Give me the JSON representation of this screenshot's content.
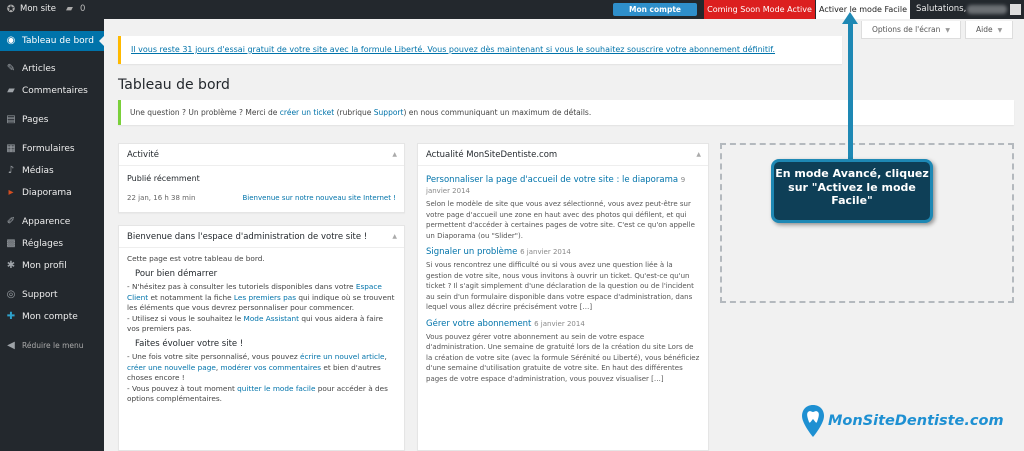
{
  "adminbar": {
    "site_name": "Mon site",
    "comments_count": "0",
    "mon_compte": "Mon compte",
    "coming_soon": "Coming Soon Mode Active",
    "activer_facile": "Activer le mode Facile",
    "salutations": "Salutations,"
  },
  "sidebar": {
    "items": [
      {
        "label": "Tableau de bord",
        "icon": "dashboard-icon"
      },
      {
        "label": "Articles",
        "icon": "pin-icon"
      },
      {
        "label": "Commentaires",
        "icon": "comment-icon"
      },
      {
        "label": "Pages",
        "icon": "page-icon"
      },
      {
        "label": "Formulaires",
        "icon": "forms-icon"
      },
      {
        "label": "Médias",
        "icon": "media-icon"
      },
      {
        "label": "Diaporama",
        "icon": "slideshow-icon"
      },
      {
        "label": "Apparence",
        "icon": "brush-icon"
      },
      {
        "label": "Réglages",
        "icon": "settings-icon"
      },
      {
        "label": "Mon profil",
        "icon": "gear-icon"
      },
      {
        "label": "Support",
        "icon": "lifebuoy-icon"
      },
      {
        "label": "Mon compte",
        "icon": "plus-icon"
      }
    ],
    "collapse": "Réduire le menu"
  },
  "screen_options": {
    "options": "Options de l'écran",
    "aide": "Aide"
  },
  "notice": {
    "trial": "Il vous reste 31 jours d'essai gratuit de votre site avec la formule Liberté. Vous pouvez dès maintenant si vous le souhaitez souscrire votre abonnement définitif."
  },
  "page_title": "Tableau de bord",
  "question": {
    "before": "Une question ? Un problème ? Merci de ",
    "link1": "créer un ticket",
    "middle": " (rubrique ",
    "link2": "Support",
    "after": ") en nous communiquant un maximum de détails."
  },
  "activite": {
    "title": "Activité",
    "subtitle": "Publié récemment",
    "date": "22 jan, 16 h 38 min",
    "post_link": "Bienvenue sur notre nouveau site Internet !"
  },
  "bienvenue": {
    "title": "Bienvenue dans l'espace d'administration de votre site !",
    "intro": "Cette page est votre tableau de bord.",
    "h1": "Pour bien démarrer",
    "p1a": "- N'hésitez pas à consulter les tutoriels disponibles dans votre ",
    "p1_link1": "Espace Client",
    "p1b": " et notamment la fiche ",
    "p1_link2": "Les premiers pas",
    "p1c": " qui indique où se trouvent les éléments que vous devrez personnaliser pour commencer.",
    "p2a": "- Utilisez si vous le souhaitez le ",
    "p2_link": "Mode Assistant",
    "p2b": " qui vous aidera à faire vos premiers pas.",
    "h2": "Faites évoluer votre site !",
    "p3a": "- Une fois votre site personnalisé, vous pouvez ",
    "p3_link1": "écrire un nouvel article",
    "p3b": ", ",
    "p3_link2": "créer une nouvelle page",
    "p3c": ", ",
    "p3_link3": "modérer vos commentaires",
    "p3d": " et bien d'autres choses encore !",
    "p4a": "- Vous pouvez à tout moment ",
    "p4_link": "quitter le mode facile",
    "p4b": " pour accéder à des options complémentaires."
  },
  "actualite": {
    "title": "Actualité MonSiteDentiste.com",
    "items": [
      {
        "title": "Personnaliser la page d'accueil de votre site : le diaporama",
        "date": "9 janvier 2014",
        "excerpt": "Selon le modèle de site que vous avez sélectionné, vous avez peut-être sur votre page d'accueil une zone en haut avec des photos qui défilent, et qui permettent d'accéder à certaines pages de votre site. C'est ce qu'on appelle un Diaporama (ou \"Slider\")."
      },
      {
        "title": "Signaler un problème",
        "date": "6 janvier 2014",
        "excerpt": "Si vous rencontrez une difficulté ou si vous avez une question liée à la gestion de votre site, nous vous invitons à ouvrir un ticket. Qu'est-ce qu'un ticket ? Il s'agit simplement d'une déclaration de la question ou de l'incident au sein d'un formulaire disponible dans votre espace d'administration, dans lequel vous allez décrire précisément votre […]"
      },
      {
        "title": "Gérer votre abonnement",
        "date": "6 janvier 2014",
        "excerpt": "Vous pouvez gérer votre abonnement au sein de votre espace d'administration. Une semaine de gratuité lors de la création du site Lors de la création de votre site (avec la formule Sérénité ou Liberté), vous bénéficiez d'une semaine d'utilisation gratuite de votre site. En haut des différentes pages de votre espace d'administration, vous pouvez visualiser […]"
      }
    ]
  },
  "callout": {
    "text": "En mode Avancé, cliquez sur \"Activez le mode Facile\""
  },
  "brand": {
    "text": "MonSiteDentiste.com"
  },
  "colors": {
    "accent": "#0073aa",
    "admin_bar": "#23282d",
    "coming_soon": "#dc1f1f",
    "callout_bg": "#0e3f57",
    "callout_border": "#1e88b4",
    "brand": "#1e90d2"
  }
}
